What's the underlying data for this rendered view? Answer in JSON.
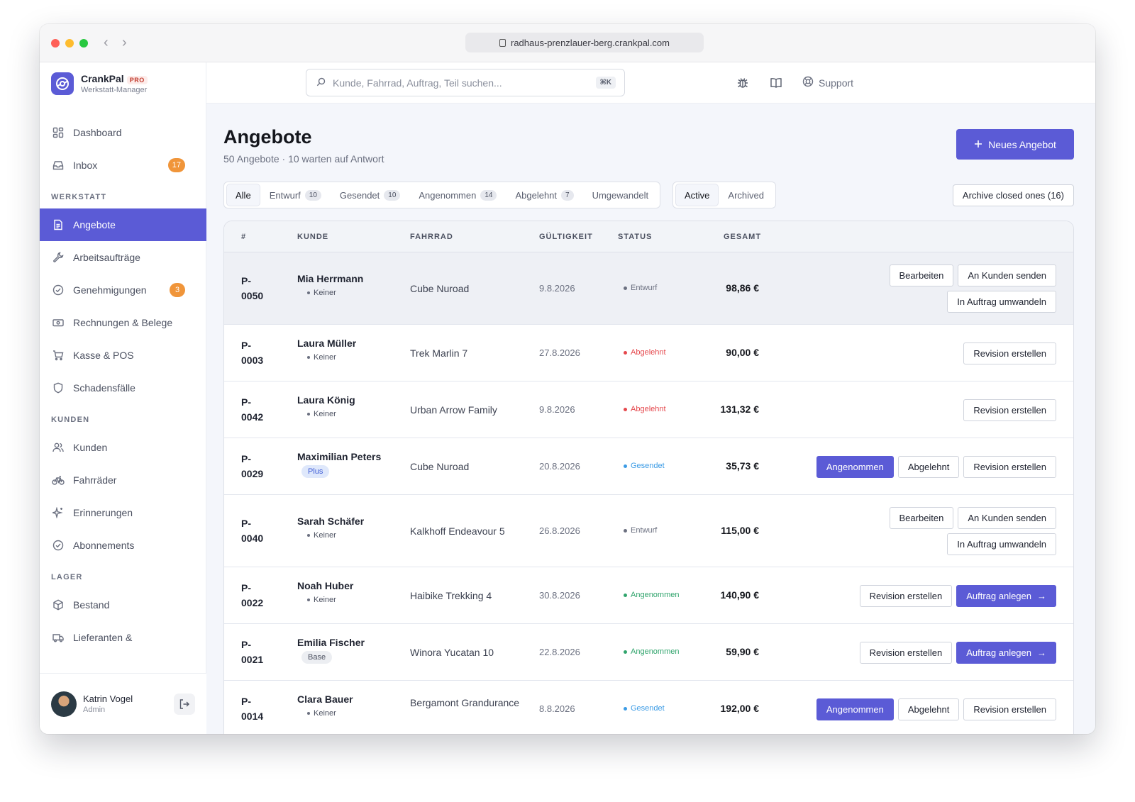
{
  "browser": {
    "url": "radhaus-prenzlauer-berg.crankpal.com"
  },
  "brand": {
    "name": "CrankPal",
    "tier": "PRO",
    "subtitle": "Werkstatt-Manager"
  },
  "nav": {
    "dashboard": "Dashboard",
    "inbox": "Inbox",
    "inbox_badge": "17",
    "section_werkstatt": "WERKSTATT",
    "angebote": "Angebote",
    "arbeitsauftraege": "Arbeitsaufträge",
    "genehmigungen": "Genehmigungen",
    "genehmigungen_badge": "3",
    "rechnungen": "Rechnungen & Belege",
    "kasse": "Kasse & POS",
    "schadensfaelle": "Schadensfälle",
    "section_kunden": "KUNDEN",
    "kunden": "Kunden",
    "fahrraeder": "Fahrräder",
    "erinnerungen": "Erinnerungen",
    "abonnements": "Abonnements",
    "section_lager": "LAGER",
    "bestand": "Bestand",
    "lieferanten": "Lieferanten &"
  },
  "user": {
    "name": "Katrin Vogel",
    "role": "Admin"
  },
  "topbar": {
    "search_placeholder": "Kunde, Fahrrad, Auftrag, Teil suchen...",
    "shortcut": "⌘K",
    "support": "Support"
  },
  "page": {
    "title": "Angebote",
    "subtitle": "50 Angebote · 10 warten auf Antwort",
    "new_button": "Neues Angebot",
    "archive_button": "Archive closed ones (16)"
  },
  "tabs": [
    {
      "label": "Alle",
      "count": ""
    },
    {
      "label": "Entwurf",
      "count": "10"
    },
    {
      "label": "Gesendet",
      "count": "10"
    },
    {
      "label": "Angenommen",
      "count": "14"
    },
    {
      "label": "Abgelehnt",
      "count": "7"
    },
    {
      "label": "Umgewandelt",
      "count": ""
    }
  ],
  "segment": {
    "active": "Active",
    "archived": "Archived"
  },
  "table": {
    "headers": {
      "id": "#",
      "kunde": "KUNDE",
      "fahrrad": "FAHRRAD",
      "gueltigkeit": "GÜLTIGKEIT",
      "status": "STATUS",
      "gesamt": "GESAMT"
    },
    "rows": [
      {
        "id": "P-0050",
        "customer": "Mia Herrmann",
        "tier": "Keiner",
        "bike": "Cube Nuroad",
        "valid": "9.8.2026",
        "status": "Entwurf",
        "total": "98,86 €",
        "a1": "Bearbeiten",
        "a2": "An Kunden senden",
        "a3": "In Auftrag umwandeln"
      },
      {
        "id": "P-0003",
        "customer": "Laura Müller",
        "tier": "Keiner",
        "bike": "Trek Marlin 7",
        "valid": "27.8.2026",
        "status": "Abgelehnt",
        "total": "90,00 €",
        "a1": "Revision erstellen"
      },
      {
        "id": "P-0042",
        "customer": "Laura König",
        "tier": "Keiner",
        "bike": "Urban Arrow Family",
        "valid": "9.8.2026",
        "status": "Abgelehnt",
        "total": "131,32 €",
        "a1": "Revision erstellen"
      },
      {
        "id": "P-0029",
        "customer": "Maximilian Peters",
        "tier": "Plus",
        "bike": "Cube Nuroad",
        "valid": "20.8.2026",
        "status": "Gesendet",
        "total": "35,73 €",
        "a1": "Angenommen",
        "a2": "Abgelehnt",
        "a3": "Revision erstellen"
      },
      {
        "id": "P-0040",
        "customer": "Sarah Schäfer",
        "tier": "Keiner",
        "bike": "Kalkhoff Endeavour 5",
        "valid": "26.8.2026",
        "status": "Entwurf",
        "total": "115,00 €",
        "a1": "Bearbeiten",
        "a2": "An Kunden senden",
        "a3": "In Auftrag umwandeln"
      },
      {
        "id": "P-0022",
        "customer": "Noah Huber",
        "tier": "Keiner",
        "bike": "Haibike Trekking 4",
        "valid": "30.8.2026",
        "status": "Angenommen",
        "total": "140,90 €",
        "a1": "Revision erstellen",
        "a2": "Auftrag anlegen"
      },
      {
        "id": "P-0021",
        "customer": "Emilia Fischer",
        "tier": "Base",
        "bike": "Winora Yucatan 10",
        "valid": "22.8.2026",
        "status": "Angenommen",
        "total": "59,90 €",
        "a1": "Revision erstellen",
        "a2": "Auftrag anlegen"
      },
      {
        "id": "P-0014",
        "customer": "Clara Bauer",
        "tier": "Keiner",
        "bike": "Bergamont Grandurance",
        "valid": "8.8.2026",
        "status": "Gesendet",
        "total": "192,00 €",
        "a1": "Angenommen",
        "a2": "Abgelehnt",
        "a3": "Revision erstellen"
      }
    ]
  },
  "colors": {
    "accent": "#5b5bd6",
    "entwurf": "#6b7080",
    "abgelehnt": "#e5484d",
    "gesendet": "#3b9be5",
    "angenommen": "#30a46c",
    "badge": "#f0953a"
  }
}
